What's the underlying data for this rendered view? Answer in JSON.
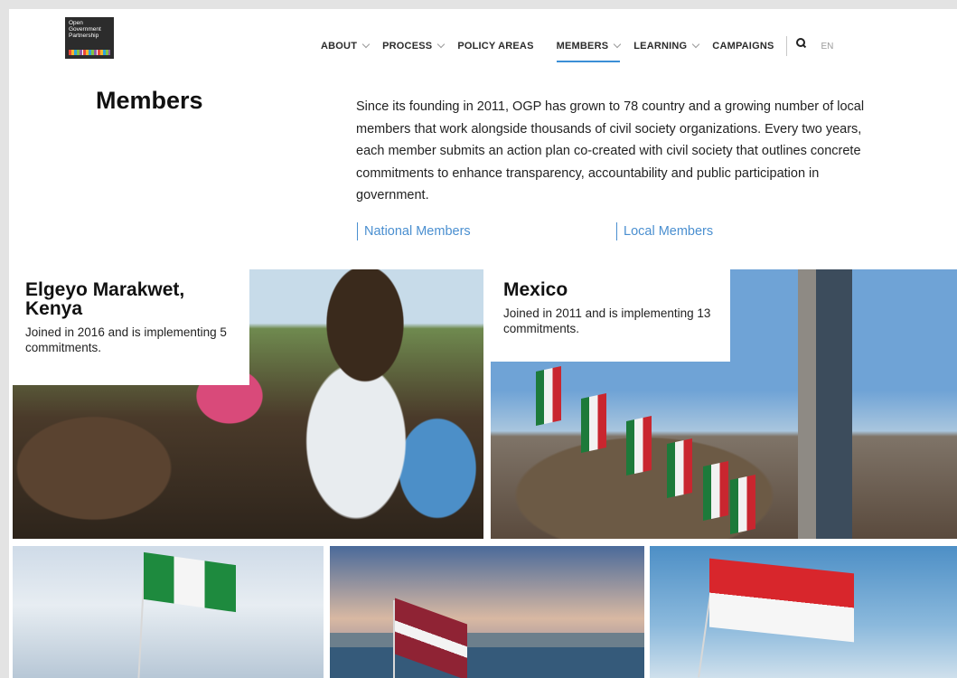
{
  "logo": {
    "text": "Open\nGovernment\nPartnership"
  },
  "nav": {
    "items": [
      {
        "label": "ABOUT",
        "dropdown": true
      },
      {
        "label": "PROCESS",
        "dropdown": true
      },
      {
        "label": "POLICY AREAS",
        "dropdown": false
      },
      {
        "label": "MEMBERS",
        "dropdown": true,
        "active": true
      },
      {
        "label": "LEARNING",
        "dropdown": true
      },
      {
        "label": "CAMPAIGNS",
        "dropdown": false
      }
    ],
    "search_icon": "search-icon",
    "language": "EN"
  },
  "intro": {
    "title": "Members",
    "text": "Since its founding in 2011, OGP has grown to 78 country and a growing number of local members that work alongside thousands of civil society organizations. Every two years, each member submits an action plan co-created with civil society that outlines concrete commitments to enhance transparency, accountability and public participation in government.",
    "links": {
      "national": "National Members",
      "local": "Local Members"
    }
  },
  "cards": [
    {
      "name": "Elgeyo Marakwet, Kenya",
      "subtitle": "Joined in 2016 and is implementing 5 commitments."
    },
    {
      "name": "Mexico",
      "subtitle": "Joined in 2011 and is implementing 13 commitments."
    }
  ],
  "colors": {
    "accent": "#3b8fd6",
    "link": "#4a8fd0",
    "text": "#222222"
  }
}
